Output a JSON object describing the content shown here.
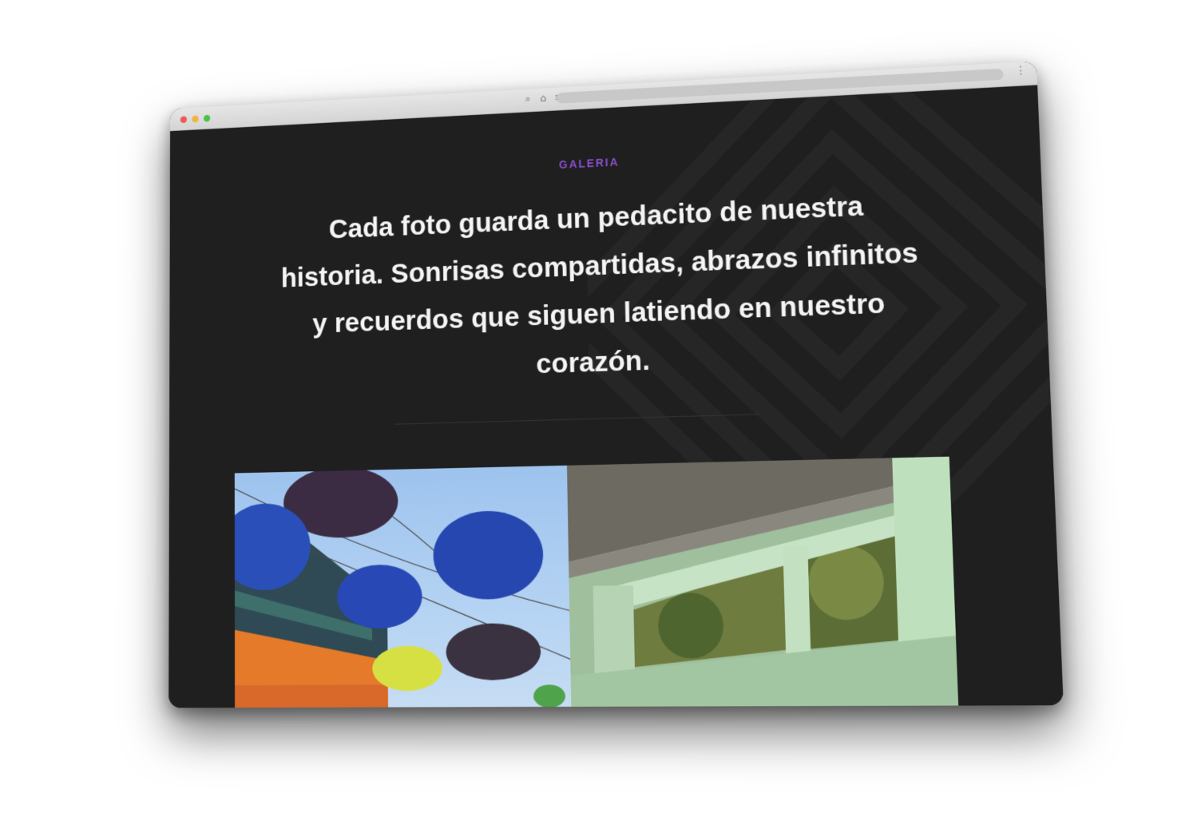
{
  "window": {
    "controls": [
      "close",
      "minimize",
      "maximize"
    ],
    "nav_icons": [
      "search-icon",
      "home-icon",
      "site-info-icon"
    ],
    "menu_icon": "more-vertical-icon"
  },
  "section": {
    "kicker": "GALERIA",
    "headline": "Cada foto guarda un pedacito de nuestra historia. Sonrisas compartidas, abrazos infinitos y recuerdos que siguen latiendo en nuestro corazón."
  },
  "gallery": {
    "photos": [
      {
        "subject": "colorful umbrellas hanging over a street"
      },
      {
        "subject": "green terrace wall with trees"
      }
    ]
  },
  "colors": {
    "page_background": "#1f1f1f",
    "kicker": "#8a4fd0",
    "headline": "#f4f4f4"
  }
}
